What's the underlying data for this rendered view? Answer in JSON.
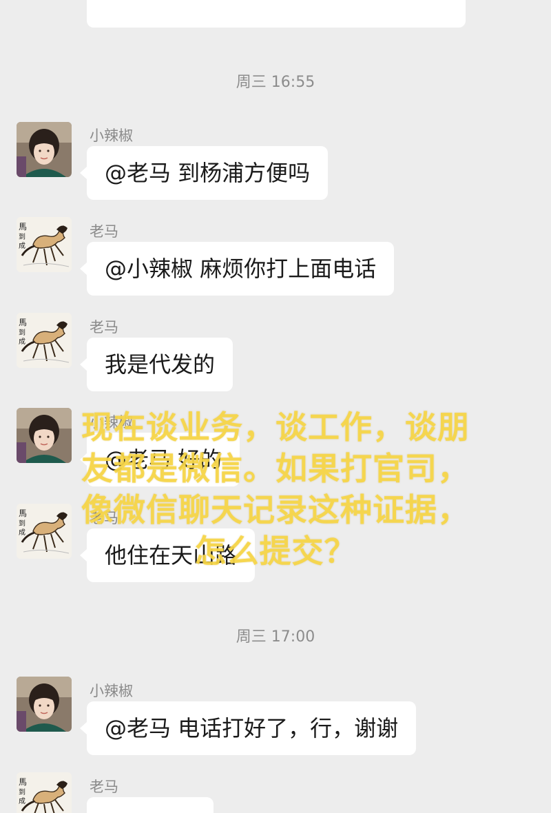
{
  "timestamps": [
    "周三 16:55",
    "周三 17:00"
  ],
  "messages": [
    {
      "sender": "小辣椒",
      "avatar": "woman-avatar",
      "text": "@老马  到杨浦方便吗"
    },
    {
      "sender": "老马",
      "avatar": "horse-avatar",
      "text": "@小辣椒  麻烦你打上面电话"
    },
    {
      "sender": "老马",
      "avatar": "horse-avatar",
      "text": "我是代发的"
    },
    {
      "sender": "小辣椒",
      "avatar": "woman-avatar",
      "text": "@老马  好的"
    },
    {
      "sender": "老马",
      "avatar": "horse-avatar",
      "text": "他住在天山路"
    },
    {
      "sender": "小辣椒",
      "avatar": "woman-avatar",
      "text": "@老马  电话打好了，行，谢谢"
    },
    {
      "sender": "老马",
      "avatar": "horse-avatar",
      "text": ""
    }
  ],
  "overlay": {
    "lines": [
      "现在谈业务，谈工作，谈朋",
      "友都是微信。如果打官司，",
      "像微信聊天记录这种证据，",
      "怎么提交？"
    ],
    "color": "#f6d648"
  },
  "colors": {
    "background": "#ededed",
    "bubble": "#ffffff",
    "timestamp": "#8c8c8c",
    "sender": "#8a8a8a"
  }
}
